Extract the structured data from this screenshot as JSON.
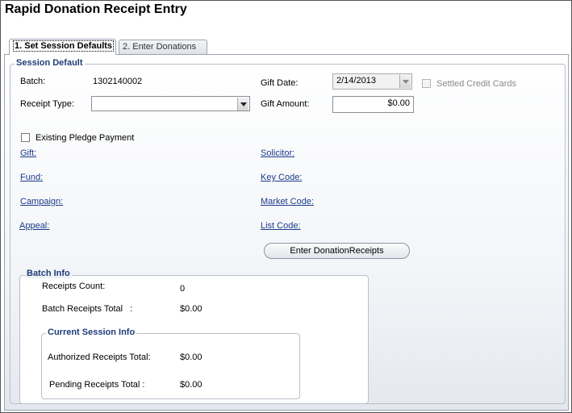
{
  "window": {
    "title": "Rapid Donation Receipt Entry"
  },
  "tabs": [
    {
      "label": "1. Set Session Defaults"
    },
    {
      "label": "2. Enter Donations"
    }
  ],
  "session_default": {
    "legend": "Session Default",
    "batch_label": "Batch:",
    "batch_value": "1302140002",
    "receipt_type_label": "Receipt Type:",
    "receipt_type_value": "",
    "gift_date_label": "Gift Date:",
    "gift_date_value": "2/14/2013",
    "settled_credit_cards_label": "Settled Credit Cards",
    "gift_amount_label": "Gift Amount:",
    "gift_amount_value": "$0.00",
    "existing_pledge_label": "Existing Pledge Payment",
    "links": {
      "gift": "Gift:",
      "fund": "Fund:",
      "campaign": "Campaign:",
      "appeal": "Appeal:",
      "solicitor": "Solicitor:",
      "key_code": "Key Code:",
      "market_code": "Market Code:",
      "list_code": "List Code:"
    },
    "enter_button": "Enter DonationReceipts"
  },
  "batch_info": {
    "legend": "Batch Info",
    "receipts_count_label": "Receipts Count:",
    "receipts_count_value": "0",
    "batch_total_label": "Batch Receipts Total   :",
    "batch_total_value": "$0.00"
  },
  "current_session": {
    "legend": "Current Session Info",
    "authorized_label": "Authorized Receipts Total:",
    "authorized_value": "$0.00",
    "pending_label": "Pending Receipts Total :",
    "pending_value": "$0.00"
  }
}
